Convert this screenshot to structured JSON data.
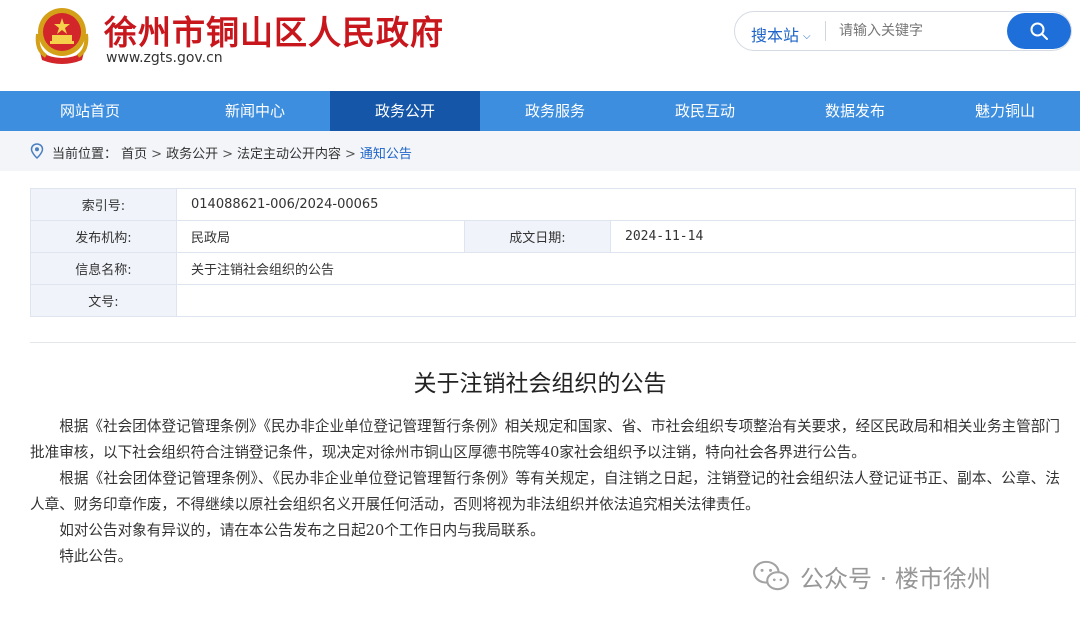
{
  "header": {
    "site_title": "徐州市铜山区人民政府",
    "site_url": "www.zgts.gov.cn",
    "emblem_icon": "national-emblem-icon",
    "search": {
      "scope_label": "搜本站",
      "placeholder": "请输入关键字",
      "button_icon": "search-icon"
    }
  },
  "nav": {
    "items": [
      "网站首页",
      "新闻中心",
      "政务公开",
      "政务服务",
      "政民互动",
      "数据发布",
      "魅力铜山"
    ],
    "active_index": 2
  },
  "breadcrumb": {
    "label": "当前位置：",
    "items": [
      "首页",
      "政务公开",
      "法定主动公开内容",
      "通知公告"
    ],
    "separator": ">"
  },
  "meta": {
    "index_label": "索引号:",
    "index_value": "014088621-006/2024-00065",
    "publisher_label": "发布机构:",
    "publisher_value": "民政局",
    "date_label": "成文日期:",
    "date_value": "2024-11-14",
    "title_label": "信息名称:",
    "title_value": "关于注销社会组织的公告",
    "docno_label": "文号:",
    "docno_value": ""
  },
  "article": {
    "title": "关于注销社会组织的公告",
    "paragraphs": [
      "根据《社会团体登记管理条例》《民办非企业单位登记管理暂行条例》相关规定和国家、省、市社会组织专项整治有关要求，经区民政局和相关业务主管部门批准审核，以下社会组织符合注销登记条件，现决定对徐州市铜山区厚德书院等40家社会组织予以注销，特向社会各界进行公告。",
      "根据《社会团体登记管理条例》、《民办非企业单位登记管理暂行条例》等有关规定，自注销之日起，注销登记的社会组织法人登记证书正、副本、公章、法人章、财务印章作废，不得继续以原社会组织名义开展任何活动，否则将视为非法组织并依法追究相关法律责任。",
      "如对公告对象有异议的，请在本公告发布之日起20个工作日内与我局联系。",
      "特此公告。"
    ]
  },
  "watermark": {
    "icon": "wechat-icon",
    "text": "公众号 · 楼市徐州"
  },
  "colors": {
    "brand_red": "#c8161d",
    "nav_blue": "#3d8ede",
    "nav_active": "#1556a8",
    "link_blue": "#1e64c8"
  }
}
